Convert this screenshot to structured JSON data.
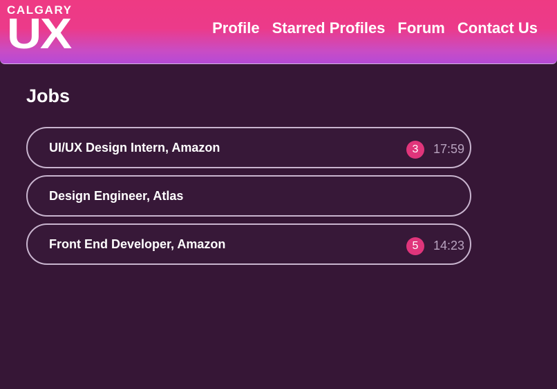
{
  "logo": {
    "top_text": "CALGARY",
    "big_text": "UX"
  },
  "nav": [
    {
      "label": "Profile"
    },
    {
      "label": "Starred Profiles"
    },
    {
      "label": "Forum"
    },
    {
      "label": "Contact Us"
    }
  ],
  "page": {
    "title": "Jobs"
  },
  "jobs": [
    {
      "title": "UI/UX Design Intern, Amazon",
      "badge": "3",
      "time": "17:59"
    },
    {
      "title": "Design Engineer, Atlas",
      "badge": "",
      "time": ""
    },
    {
      "title": "Front End Developer, Amazon",
      "badge": "5",
      "time": "14:23"
    }
  ],
  "colors": {
    "background": "#361636",
    "header_gradient_top": "#ee3a83",
    "header_gradient_bottom": "#b54ad6",
    "badge": "#e0357b",
    "card_border": "#c9b5cf"
  }
}
